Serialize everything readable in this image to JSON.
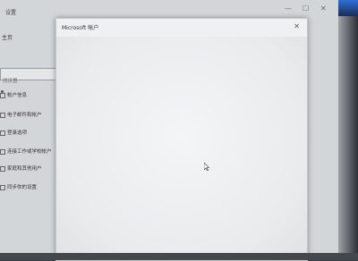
{
  "window": {
    "app_title": "设置",
    "home_label": "主页",
    "search_placeholder": "找设置",
    "controls": {
      "minimize": "—",
      "maximize": "☐",
      "close": "✕"
    }
  },
  "sidebar": {
    "items": [
      {
        "label": "帐户信息",
        "icon": "person-icon"
      },
      {
        "label": "电子邮件和帐户",
        "icon": "mail-icon"
      },
      {
        "label": "登录选项",
        "icon": "key-icon"
      },
      {
        "label": "连接工作或学校帐户",
        "icon": "briefcase-icon"
      },
      {
        "label": "家庭和其他用户",
        "icon": "people-icon"
      },
      {
        "label": "同步你的设置",
        "icon": "sync-icon"
      }
    ]
  },
  "dialog": {
    "title": "Microsoft 帐户",
    "close": "✕"
  },
  "colors": {
    "dialog_bg": "#eef0f1",
    "window_bg": "#d3d6d9"
  }
}
